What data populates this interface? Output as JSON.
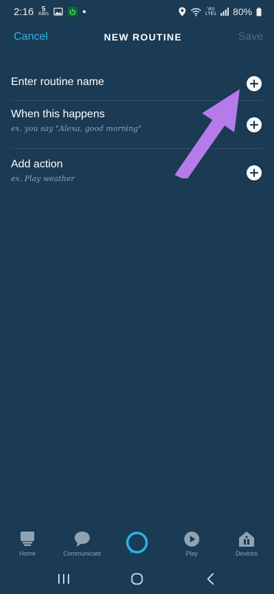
{
  "status_bar": {
    "time": "2:16",
    "net_speed_value": "5",
    "net_speed_unit": "KB/s",
    "volte_top": "Vo)",
    "volte_bottom": "LTE1",
    "battery": "80%"
  },
  "header": {
    "cancel_label": "Cancel",
    "title": "NEW ROUTINE",
    "save_label": "Save"
  },
  "rows": [
    {
      "title": "Enter routine name",
      "subtitle": ""
    },
    {
      "title": "When this happens",
      "subtitle": "ex. you say \"Alexa, good morning\""
    },
    {
      "title": "Add action",
      "subtitle": "ex. Play weather"
    }
  ],
  "bottom_nav": {
    "home": "Home",
    "communicate": "Communicate",
    "play": "Play",
    "devices": "Devices"
  },
  "colors": {
    "background": "#1b3a53",
    "accent": "#29b6e6",
    "annotation_arrow": "#b57bea"
  }
}
